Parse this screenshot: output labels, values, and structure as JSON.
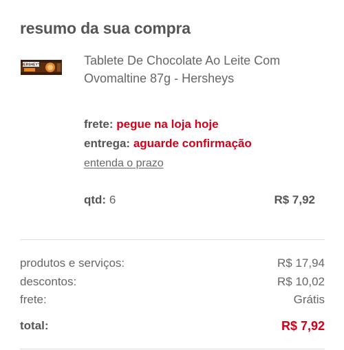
{
  "summary": {
    "title": "resumo da sua compra"
  },
  "product": {
    "image_icon": "hersheys-chocolate-bar-image",
    "brand_text": "HERSHEY'S",
    "name": "Tablete De Chocolate Ao Leite Com Ovomaltine 87g - Hersheys",
    "frete_label": "frete:",
    "frete_value": "pegue na loja hoje",
    "entrega_label": "entrega:",
    "entrega_value": "aguarde confirmação",
    "prazo_link": "entenda o prazo",
    "qtd_label": "qtd:",
    "qtd_value": "6",
    "price": "R$ 7,92"
  },
  "totals": {
    "produtos_label": "produtos e serviços:",
    "produtos_value": "R$ 17,94",
    "descontos_label": "descontos:",
    "descontos_value": "R$ 10,02",
    "frete_label": "frete:",
    "frete_value": "Grátis",
    "total_label": "total:",
    "total_value": "R$ 7,92"
  },
  "colors": {
    "accent_red": "#d4001a",
    "text_gray": "#666666",
    "divider": "#dddddd"
  }
}
